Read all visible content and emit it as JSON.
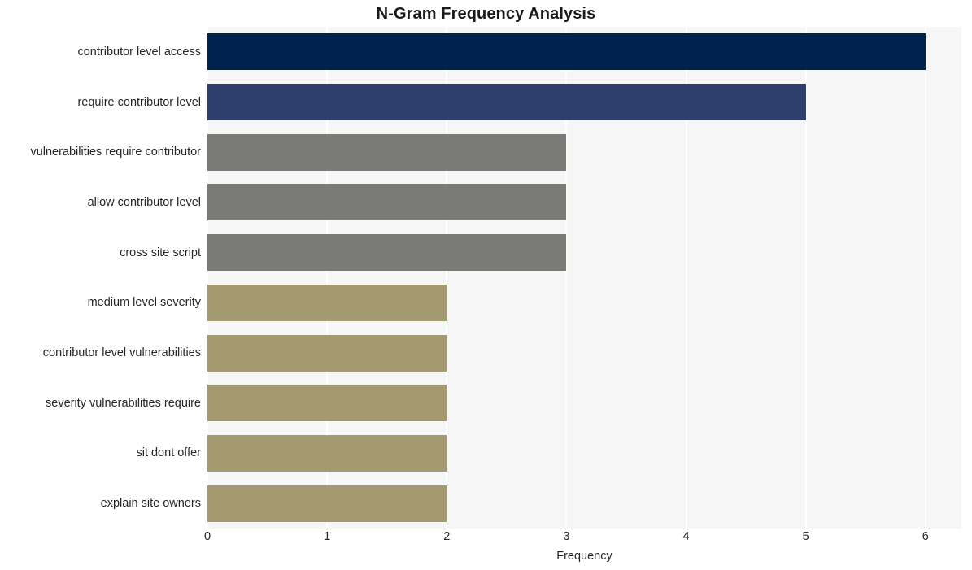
{
  "chart_data": {
    "type": "bar",
    "orientation": "horizontal",
    "title": "N-Gram Frequency Analysis",
    "xlabel": "Frequency",
    "ylabel": "",
    "xlim": [
      0,
      6.3
    ],
    "xticks": [
      0,
      1,
      2,
      3,
      4,
      5,
      6
    ],
    "xtick_labels": [
      "0",
      "1",
      "2",
      "3",
      "4",
      "5",
      "6"
    ],
    "grid": true,
    "grid_axis": "x",
    "legend": false,
    "plot_background": "#f6f6f7",
    "figure_background": "#ffffff",
    "gridline_color": "#ffffff",
    "categories": [
      "contributor level access",
      "require contributor level",
      "vulnerabilities require contributor",
      "allow contributor level",
      "cross site script",
      "medium level severity",
      "contributor level vulnerabilities",
      "severity vulnerabilities require",
      "sit dont offer",
      "explain site owners"
    ],
    "values": [
      6,
      5,
      3,
      3,
      3,
      2,
      2,
      2,
      2,
      2
    ],
    "bar_colors": [
      "#00224e",
      "#2e3f6d",
      "#7a7a77",
      "#7a7a77",
      "#7a7a77",
      "#a49a71",
      "#a49a71",
      "#a49a71",
      "#a49a71",
      "#a49a71"
    ]
  }
}
